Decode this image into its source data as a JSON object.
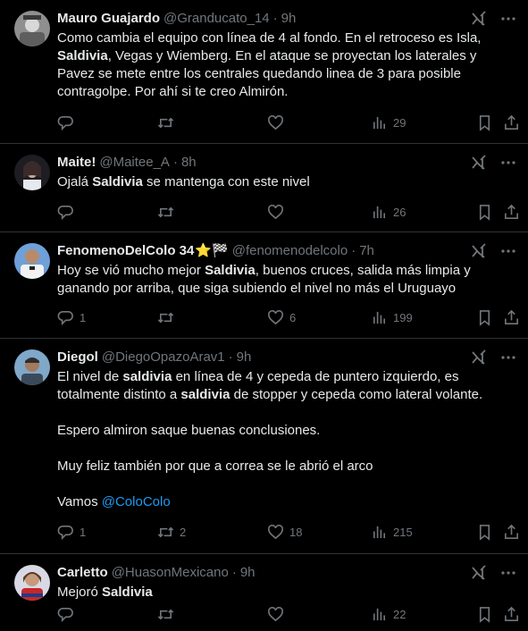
{
  "tweets": [
    {
      "name": "Mauro Guajardo",
      "handle": "@Granducato_14",
      "dot": "·",
      "time": "9h",
      "emoji": "",
      "parts": [
        {
          "t": "Como cambia el equipo con línea de 4 al fondo. En el retroceso es Isla, "
        },
        {
          "t": "Saldivia",
          "b": true
        },
        {
          "t": ", Vegas y Wiemberg. En el ataque se proyectan los laterales y Pavez se mete entre los centrales quedando linea de 3 para posible contragolpe. Por ahí si te creo Almirón."
        }
      ],
      "replies": "",
      "retweets": "",
      "likes": "",
      "views": "29",
      "avatar": "mauro"
    },
    {
      "name": "Maite!",
      "handle": "@Maitee_A",
      "dot": "·",
      "time": "8h",
      "emoji": "",
      "parts": [
        {
          "t": "Ojalá "
        },
        {
          "t": "Saldivia",
          "b": true
        },
        {
          "t": " se mantenga con este nivel"
        }
      ],
      "replies": "",
      "retweets": "",
      "likes": "",
      "views": "26",
      "avatar": "maite"
    },
    {
      "name": "FenomenoDelColo 34",
      "handle": "@fenomenodelcolo",
      "dot": "·",
      "time": "7h",
      "emoji": "⭐🏁",
      "parts": [
        {
          "t": "Hoy se vió mucho mejor "
        },
        {
          "t": "Saldivia",
          "b": true
        },
        {
          "t": ", buenos cruces, salida más limpia y ganando por arriba, que siga subiendo el nivel no más el Uruguayo"
        }
      ],
      "replies": "1",
      "retweets": "",
      "likes": "6",
      "views": "199",
      "avatar": "fenomeno"
    },
    {
      "name": "Diegol",
      "handle": "@DiegoOpazoArav1",
      "dot": "·",
      "time": "9h",
      "emoji": "",
      "parts": [
        {
          "t": "El nivel de "
        },
        {
          "t": "saldivia",
          "b": true
        },
        {
          "t": " en línea de 4 y cepeda de puntero izquierdo, es totalmente distinto a "
        },
        {
          "t": "saldivia",
          "b": true
        },
        {
          "t": " de stopper y cepeda como lateral volante.\n\nEspero almiron saque buenas conclusiones.\n\nMuy feliz también por que a correa se le abrió el arco\n\nVamos "
        },
        {
          "t": "@ColoColo",
          "m": true
        }
      ],
      "replies": "1",
      "retweets": "2",
      "likes": "18",
      "views": "215",
      "avatar": "diegol"
    },
    {
      "name": "Carletto",
      "handle": "@HuasonMexicano",
      "dot": "·",
      "time": "9h",
      "emoji": "",
      "parts": [
        {
          "t": "Mejoró "
        },
        {
          "t": "Saldivia",
          "b": true
        }
      ],
      "replies": "",
      "retweets": "",
      "likes": "",
      "views": "22",
      "avatar": "carletto"
    }
  ],
  "icons": {
    "reply": "reply-icon",
    "retweet": "retweet-icon",
    "like": "heart-icon",
    "views": "views-icon",
    "bookmark": "bookmark-icon",
    "share": "share-icon",
    "grok": "grok-icon",
    "more": "more-icon"
  },
  "colors": {
    "background": "#000000",
    "text": "#e7e9ea",
    "secondary": "#71767b",
    "link": "#1d9bf0",
    "divider": "#2f3336"
  }
}
